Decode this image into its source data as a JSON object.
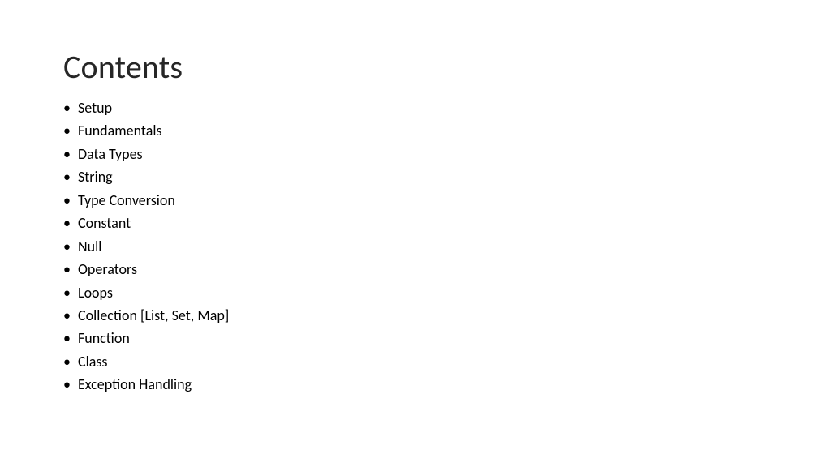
{
  "title": "Contents",
  "items": [
    "Setup",
    "Fundamentals",
    "Data Types",
    "String",
    "Type Conversion",
    "Constant",
    "Null",
    "Operators",
    "Loops",
    "Collection [List, Set, Map]",
    "Function",
    "Class",
    "Exception Handling"
  ]
}
